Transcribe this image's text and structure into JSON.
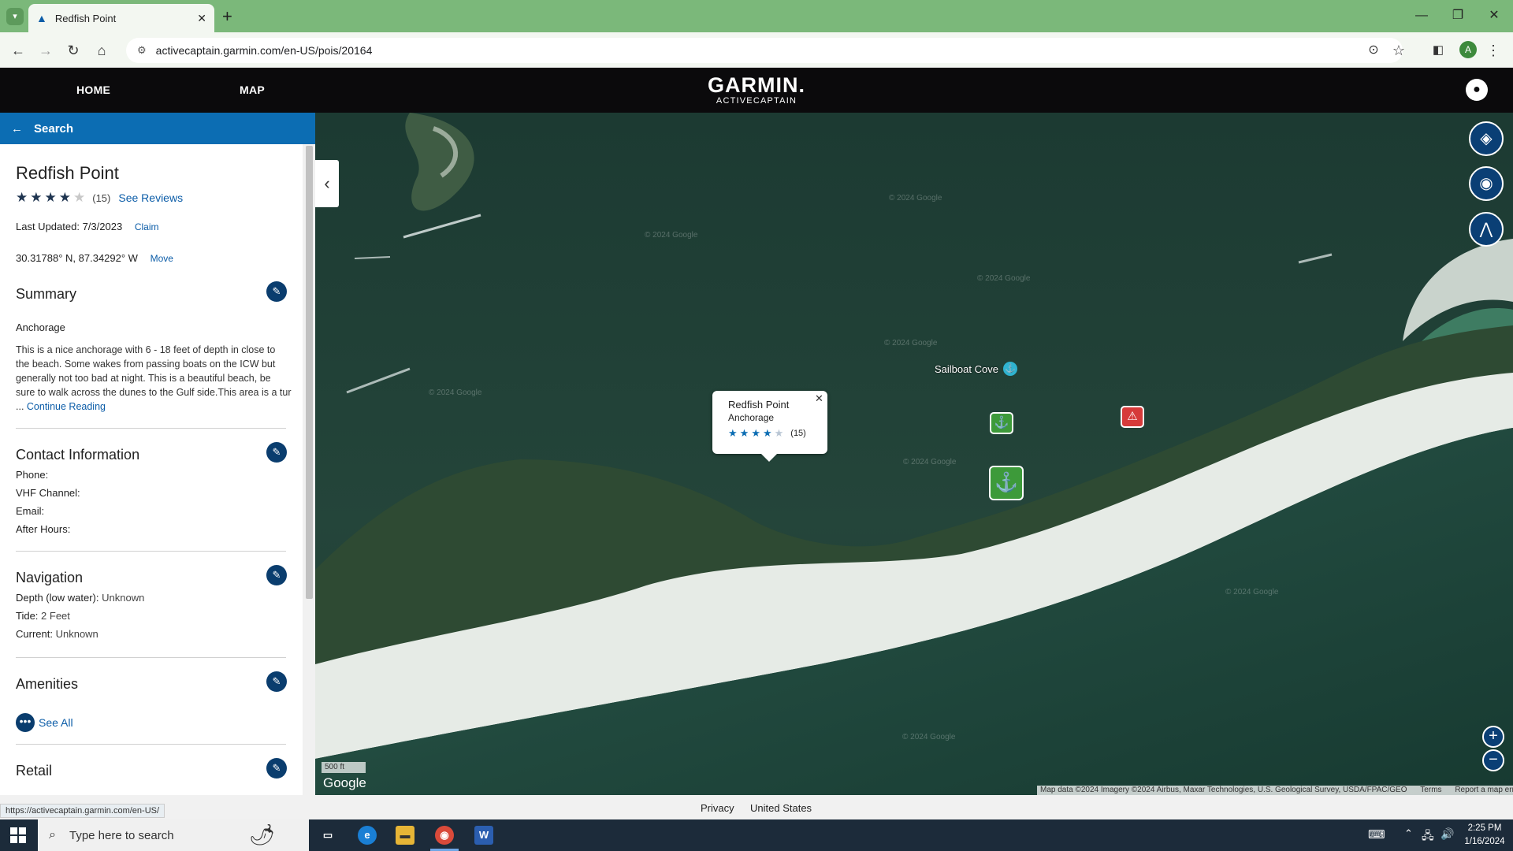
{
  "browser": {
    "tab_title": "Redfish Point",
    "url": "activecaptain.garmin.com/en-US/pois/20164",
    "profile_initial": "A",
    "status_url": "https://activecaptain.garmin.com/en-US/"
  },
  "site": {
    "nav_home": "HOME",
    "nav_map": "MAP",
    "logo_brand": "GARMIN.",
    "logo_sub": "ACTIVECAPTAIN"
  },
  "panel": {
    "search_label": "Search",
    "title": "Redfish Point",
    "rating": 4,
    "rating_max": 5,
    "review_count": "(15)",
    "see_reviews": "See Reviews",
    "last_updated_label": "Last Updated:",
    "last_updated_value": "7/3/2023",
    "claim": "Claim",
    "coordinates": "30.31788° N, 87.34292° W",
    "move": "Move",
    "summary_title": "Summary",
    "summary_type": "Anchorage",
    "summary_text": "This is a nice anchorage with 6 - 18 feet of depth in close to the beach.  Some wakes from passing boats on the ICW but generally not too bad at night.  This is a beautiful beach, be sure to walk across the dunes to the Gulf side.This area is a tur ...",
    "continue_reading": "Continue Reading",
    "contact_title": "Contact Information",
    "phone_label": "Phone:",
    "vhf_label": "VHF Channel:",
    "email_label": "Email:",
    "after_hours_label": "After Hours:",
    "navigation_title": "Navigation",
    "depth_label": "Depth (low water):",
    "depth_value": "Unknown",
    "tide_label": "Tide:",
    "tide_value": "2 Feet",
    "current_label": "Current:",
    "current_value": "Unknown",
    "amenities_title": "Amenities",
    "see_all": "See All",
    "retail_title": "Retail"
  },
  "map": {
    "popup_title": "Redfish Point",
    "popup_type": "Anchorage",
    "popup_count": "(15)",
    "sailboat_cove": "Sailboat Cove",
    "watermark": "© 2024 Google",
    "scale": "500 ft",
    "google": "Google",
    "attribution": "Map data ©2024 Imagery ©2024 Airbus, Maxar Technologies, U.S. Geological Survey, USDA/FPAC/GEO",
    "terms": "Terms",
    "report": "Report a map error"
  },
  "footer": {
    "privacy": "Privacy",
    "country": "United States"
  },
  "taskbar": {
    "search_placeholder": "Type here to search",
    "time": "2:25 PM",
    "date": "1/16/2024"
  },
  "colors": {
    "accent_blue": "#0c6db3",
    "dark_navy": "#0a3d6e",
    "header_black": "#0b0a0c",
    "marker_green": "#3d9a3a",
    "hazard_red": "#d63a3a"
  }
}
